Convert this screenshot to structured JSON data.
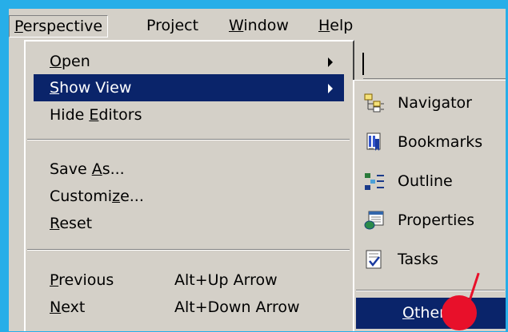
{
  "menubar": {
    "items": [
      {
        "pre": "",
        "u": "P",
        "post": "erspective"
      },
      {
        "pre": "Pro",
        "u": "j",
        "post": "ect"
      },
      {
        "pre": "",
        "u": "W",
        "post": "indow"
      },
      {
        "pre": "",
        "u": "H",
        "post": "elp"
      }
    ]
  },
  "perspective_menu": {
    "open": {
      "pre": "",
      "u": "O",
      "post": "pen"
    },
    "show_view": {
      "pre": "",
      "u": "S",
      "post": "how View"
    },
    "hide_editors": {
      "pre": "Hide ",
      "u": "E",
      "post": "ditors"
    },
    "save_as": {
      "pre": "Save ",
      "u": "A",
      "post": "s..."
    },
    "customize": {
      "pre": "Customi",
      "u": "z",
      "post": "e..."
    },
    "reset": {
      "pre": "",
      "u": "R",
      "post": "eset"
    },
    "previous": {
      "pre": "",
      "u": "P",
      "post": "revious",
      "accel": "Alt+Up Arrow"
    },
    "next": {
      "pre": "",
      "u": "N",
      "post": "ext",
      "accel": "Alt+Down Arrow"
    }
  },
  "show_view_submenu": {
    "items": [
      {
        "label": "Navigator",
        "icon": "navigator-icon"
      },
      {
        "label": "Bookmarks",
        "icon": "bookmarks-icon"
      },
      {
        "label": "Outline",
        "icon": "outline-icon"
      },
      {
        "label": "Properties",
        "icon": "properties-icon"
      },
      {
        "label": "Tasks",
        "icon": "tasks-icon"
      }
    ],
    "other": {
      "pre": "",
      "u": "O",
      "post": "ther..."
    }
  },
  "colors": {
    "background": "#27aee8",
    "menu_face": "#d4d0c8",
    "highlight": "#0a246a",
    "highlight_text": "#ffffff",
    "annotation": "#e8102a"
  }
}
